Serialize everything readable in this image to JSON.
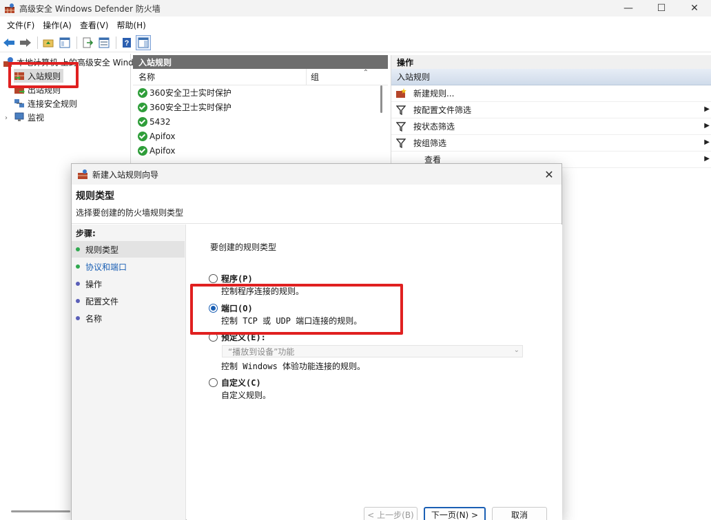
{
  "window": {
    "title": "高级安全 Windows Defender 防火墙"
  },
  "menu": [
    "文件(F)",
    "操作(A)",
    "查看(V)",
    "帮助(H)"
  ],
  "tree": {
    "root": "本地计算机 上的高级安全 Windows",
    "inbound": "入站规则",
    "outbound": "出站规则",
    "connection": "连接安全规则",
    "monitor": "监视"
  },
  "rules_pane": {
    "header": "入站规则",
    "columns": [
      "名称",
      "组"
    ],
    "rows": [
      "360安全卫士实时保护",
      "360安全卫士实时保护",
      "5432",
      "Apifox",
      "Apifox"
    ]
  },
  "actions_pane": {
    "header": "操作",
    "group": "入站规则",
    "items": [
      "新建规则...",
      "按配置文件筛选",
      "按状态筛选",
      "按组筛选",
      "查看"
    ]
  },
  "dialog": {
    "title": "新建入站规则向导",
    "heading": "规则类型",
    "subheading": "选择要创建的防火墙规则类型",
    "steps_title": "步骤:",
    "steps": [
      "规则类型",
      "协议和端口",
      "操作",
      "配置文件",
      "名称"
    ],
    "question": "要创建的规则类型",
    "options": {
      "program": {
        "label": "程序(P)",
        "desc": "控制程序连接的规则。"
      },
      "port": {
        "label": "端口(O)",
        "desc": "控制 TCP 或 UDP 端口连接的规则。"
      },
      "predefined": {
        "label": "预定义(E):",
        "combo": "“播放到设备”功能",
        "desc": "控制 Windows 体验功能连接的规则。"
      },
      "custom": {
        "label": "自定义(C)",
        "desc": "自定义规则。"
      }
    },
    "selected_option": "port",
    "buttons": {
      "back": "< 上一步(B)",
      "next": "下一页(N) >",
      "cancel": "取消"
    }
  },
  "colors": {
    "highlight": "#e02020",
    "accent": "#1a5fb4",
    "step_done": "#2fa84f",
    "step_pending": "#5a5fb8"
  }
}
